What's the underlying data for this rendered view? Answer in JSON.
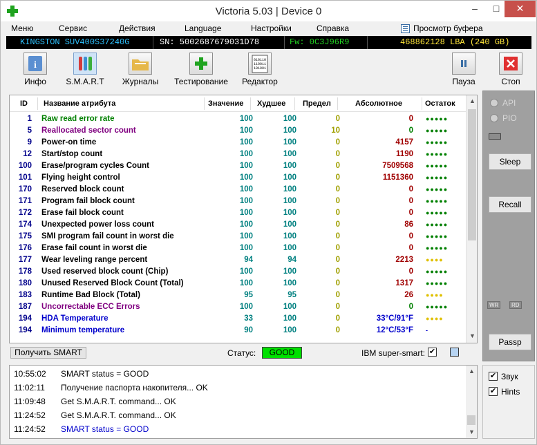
{
  "window": {
    "title": "Victoria 5.03 | Device 0",
    "min_glyph": "–",
    "max_glyph": "□",
    "close_glyph": "✕"
  },
  "menu": {
    "items": [
      "Меню",
      "Сервис",
      "Действия",
      "Language",
      "Настройки",
      "Справка"
    ],
    "buffer_view": "Просмотр буфера"
  },
  "device": {
    "model": "KINGSTON SUV400S37240G",
    "serial": "SN: 5002687679031D78",
    "firmware": "Fw: 0C3J96R9",
    "capacity": "468862128 LBA (240 GB)"
  },
  "toolbar": {
    "info": "Инфо",
    "smart": "S.M.A.R.T",
    "journals": "Журналы",
    "testing": "Тестирование",
    "editor": "Редактор",
    "pause": "Пауза",
    "stop": "Стоп"
  },
  "table": {
    "headers": {
      "id": "ID",
      "name": "Название атрибута",
      "value": "Значение",
      "worst": "Худшее",
      "threshold": "Предел",
      "raw": "Абсолютное",
      "health": "Остаток"
    },
    "rows": [
      {
        "id": "1",
        "name": "Raw read error rate",
        "value": "100",
        "worst": "100",
        "threshold": "0",
        "raw": "0",
        "health": "●●●●●",
        "name_color": "#008000",
        "health_color": "#008000"
      },
      {
        "id": "5",
        "name": "Reallocated sector count",
        "value": "100",
        "worst": "100",
        "threshold": "10",
        "raw": "0",
        "health": "●●●●●",
        "name_color": "#800080",
        "health_color": "#008000",
        "raw_color": "#008000"
      },
      {
        "id": "9",
        "name": "Power-on time",
        "value": "100",
        "worst": "100",
        "threshold": "0",
        "raw": "4157",
        "health": "●●●●●",
        "name_color": "#000000",
        "health_color": "#008000"
      },
      {
        "id": "12",
        "name": "Start/stop count",
        "value": "100",
        "worst": "100",
        "threshold": "0",
        "raw": "1190",
        "health": "●●●●●",
        "name_color": "#000000",
        "health_color": "#008000"
      },
      {
        "id": "100",
        "name": "Erase/program cycles Count",
        "value": "100",
        "worst": "100",
        "threshold": "0",
        "raw": "7509568",
        "health": "●●●●●",
        "name_color": "#000000",
        "health_color": "#008000"
      },
      {
        "id": "101",
        "name": "Flying height control",
        "value": "100",
        "worst": "100",
        "threshold": "0",
        "raw": "1151360",
        "health": "●●●●●",
        "name_color": "#000000",
        "health_color": "#008000"
      },
      {
        "id": "170",
        "name": "Reserved block count",
        "value": "100",
        "worst": "100",
        "threshold": "0",
        "raw": "0",
        "health": "●●●●●",
        "name_color": "#000000",
        "health_color": "#008000"
      },
      {
        "id": "171",
        "name": "Program fail block count",
        "value": "100",
        "worst": "100",
        "threshold": "0",
        "raw": "0",
        "health": "●●●●●",
        "name_color": "#000000",
        "health_color": "#008000"
      },
      {
        "id": "172",
        "name": "Erase fail block count",
        "value": "100",
        "worst": "100",
        "threshold": "0",
        "raw": "0",
        "health": "●●●●●",
        "name_color": "#000000",
        "health_color": "#008000"
      },
      {
        "id": "174",
        "name": "Unexpected power loss count",
        "value": "100",
        "worst": "100",
        "threshold": "0",
        "raw": "86",
        "health": "●●●●●",
        "name_color": "#000000",
        "health_color": "#008000"
      },
      {
        "id": "175",
        "name": "SMI program fail count in worst die",
        "value": "100",
        "worst": "100",
        "threshold": "0",
        "raw": "0",
        "health": "●●●●●",
        "name_color": "#000000",
        "health_color": "#008000"
      },
      {
        "id": "176",
        "name": "Erase fail count in worst die",
        "value": "100",
        "worst": "100",
        "threshold": "0",
        "raw": "0",
        "health": "●●●●●",
        "name_color": "#000000",
        "health_color": "#008000"
      },
      {
        "id": "177",
        "name": "Wear leveling range percent",
        "value": "94",
        "worst": "94",
        "threshold": "0",
        "raw": "2213",
        "health": "●●●●",
        "name_color": "#000000",
        "health_color": "#e0c000"
      },
      {
        "id": "178",
        "name": "Used reserved block count (Chip)",
        "value": "100",
        "worst": "100",
        "threshold": "0",
        "raw": "0",
        "health": "●●●●●",
        "name_color": "#000000",
        "health_color": "#008000"
      },
      {
        "id": "180",
        "name": "Unused Reserved Block Count (Total)",
        "value": "100",
        "worst": "100",
        "threshold": "0",
        "raw": "1317",
        "health": "●●●●●",
        "name_color": "#000000",
        "health_color": "#008000"
      },
      {
        "id": "183",
        "name": "Runtime Bad Block (Total)",
        "value": "95",
        "worst": "95",
        "threshold": "0",
        "raw": "26",
        "health": "●●●●",
        "name_color": "#000000",
        "health_color": "#e0c000"
      },
      {
        "id": "187",
        "name": "Uncorrectable ECC Errors",
        "value": "100",
        "worst": "100",
        "threshold": "0",
        "raw": "0",
        "health": "●●●●●",
        "name_color": "#800080",
        "health_color": "#008000",
        "raw_color": "#008000"
      },
      {
        "id": "194",
        "name": "HDA Temperature",
        "value": "33",
        "worst": "100",
        "threshold": "0",
        "raw": "33°C/91°F",
        "health": "●●●●",
        "name_color": "#0000cc",
        "health_color": "#e0c000",
        "raw_color": "#0000cc"
      },
      {
        "id": "194",
        "name": "Minimum temperature",
        "value": "90",
        "worst": "100",
        "threshold": "0",
        "raw": "12°C/53°F",
        "health": "-",
        "name_color": "#0000cc",
        "health_color": "#0000cc",
        "raw_color": "#0000cc"
      }
    ]
  },
  "status": {
    "get_smart": "Получить SMART",
    "label": "Статус:",
    "value": "GOOD",
    "ibm": "IBM super-smart:",
    "ibm_check": "✔"
  },
  "rpanel": {
    "api": "API",
    "pio": "PIO",
    "sleep": "Sleep",
    "recall": "Recall",
    "wr": "WR",
    "rd": "RD",
    "passp": "Passp"
  },
  "log": [
    {
      "time": "10:55:02",
      "msg": "SMART status = GOOD",
      "color": "#000000"
    },
    {
      "time": "11:02:11",
      "msg": "Получение паспорта накопителя... OK",
      "color": "#000000"
    },
    {
      "time": "11:09:48",
      "msg": "Get S.M.A.R.T. command... OK",
      "color": "#000000"
    },
    {
      "time": "11:24:52",
      "msg": "Get S.M.A.R.T. command... OK",
      "color": "#000000"
    },
    {
      "time": "11:24:52",
      "msg": "SMART status = GOOD",
      "color": "#0000cc"
    }
  ],
  "options": {
    "sound": "Звук",
    "hints": "Hints",
    "check": "✔"
  },
  "colors": {
    "good": "#00e000",
    "devbar_bg": "#000000",
    "model_fg": "#2fc2ff",
    "serial_fg": "#ffffff",
    "fw_fg": "#22d122",
    "lba_fg": "#ffe53a"
  }
}
